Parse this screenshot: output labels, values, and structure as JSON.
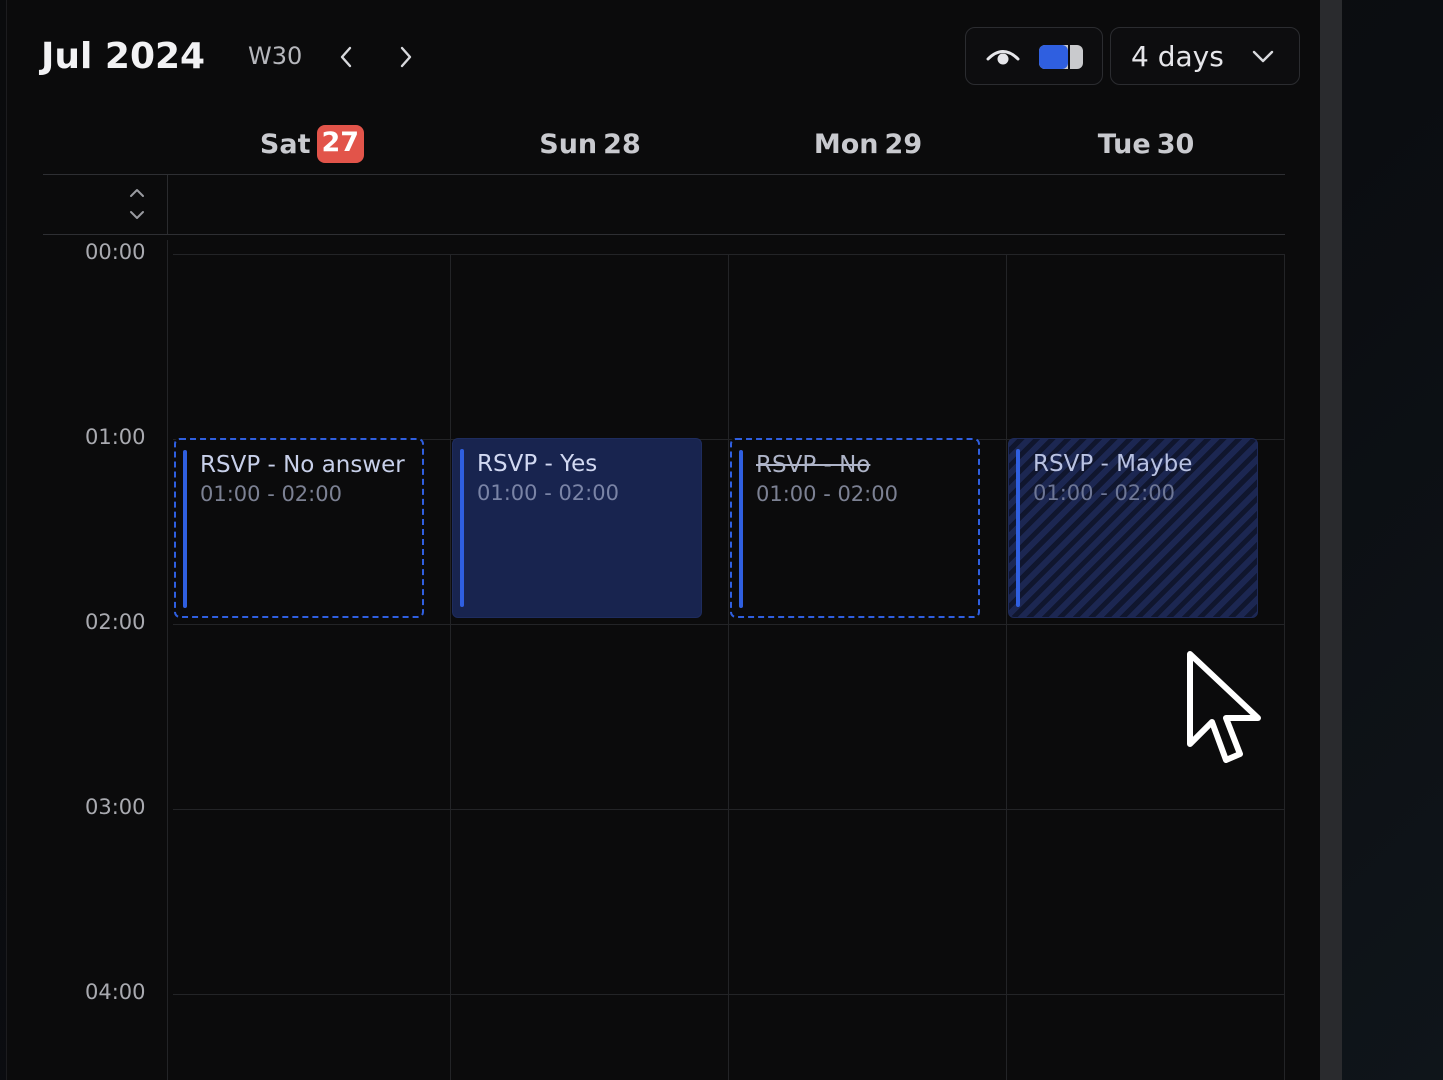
{
  "header": {
    "month_title": "Jul 2024",
    "week_label": "W30",
    "prev_icon": "chevron-left-icon",
    "next_icon": "chevron-right-icon",
    "visibility_icon": "eye-icon",
    "toggle_icon": "sidebar-toggle-icon",
    "range_select": {
      "value": "4 days",
      "icon": "chevron-down-icon"
    }
  },
  "days": [
    {
      "weekday": "Sat",
      "date": "27",
      "is_today": true
    },
    {
      "weekday": "Sun",
      "date": "28",
      "is_today": false
    },
    {
      "weekday": "Mon",
      "date": "29",
      "is_today": false
    },
    {
      "weekday": "Tue",
      "date": "30",
      "is_today": false
    }
  ],
  "all_day_row": {
    "collapse_icon": "expand-collapse-icon"
  },
  "time_labels": [
    "00:00",
    "01:00",
    "02:00",
    "03:00",
    "04:00"
  ],
  "events": [
    {
      "title": "RSVP - No answer",
      "time": "01:00 - 02:00",
      "rsvp": "no-answer"
    },
    {
      "title": "RSVP - Yes",
      "time": "01:00 - 02:00",
      "rsvp": "yes"
    },
    {
      "title": "RSVP - No",
      "time": "01:00 - 02:00",
      "rsvp": "no"
    },
    {
      "title": "RSVP - Maybe",
      "time": "01:00 - 02:00",
      "rsvp": "maybe"
    }
  ],
  "colors": {
    "accent_blue": "#2f5fe0",
    "today_badge": "#e2544a",
    "event_yes_bg": "#18244f",
    "background": "#0b0b0c"
  },
  "cursor_icon": "mouse-pointer-icon"
}
